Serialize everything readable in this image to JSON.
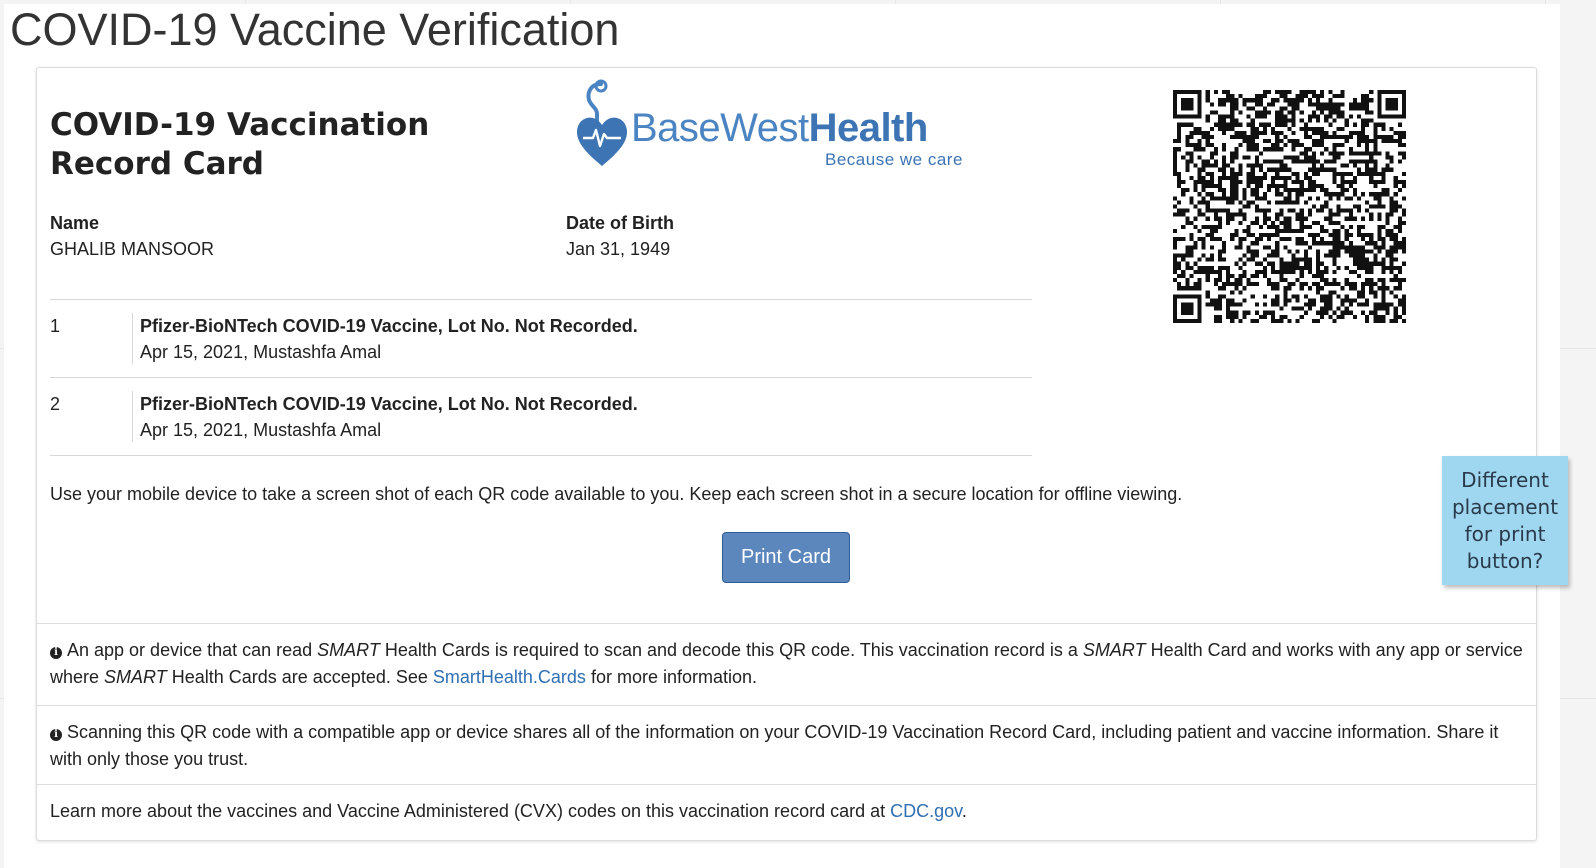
{
  "page": {
    "title": "COVID-19 Vaccine Verification"
  },
  "card": {
    "title": "COVID-19 Vaccination Record Card",
    "logo": {
      "name_part1": "BaseWest",
      "name_part2": "Health",
      "tagline": "Because we care",
      "icon": "heart-stethoscope-icon"
    },
    "qr_code": "qr-code-image",
    "name_label": "Name",
    "name_value": "GHALIB MANSOOR",
    "dob_label": "Date of Birth",
    "dob_value": "Jan 31, 1949",
    "doses": [
      {
        "number": "1",
        "vaccine": "Pfizer-BioNTech COVID-19 Vaccine, Lot No. Not Recorded.",
        "detail": "Apr 15, 2021, Mustashfa Amal"
      },
      {
        "number": "2",
        "vaccine": "Pfizer-BioNTech COVID-19 Vaccine, Lot No. Not Recorded.",
        "detail": "Apr 15, 2021, Mustashfa Amal"
      }
    ],
    "instructions": "Use your mobile device to take a screen shot of each QR code available to you. Keep each screen shot in a secure location for offline viewing.",
    "print_button": "Print Card"
  },
  "notes": {
    "smart": {
      "p1": "An app or device that can read ",
      "em1": "SMART",
      "p2": " Health Cards is required to scan and decode this QR code. This vaccination record is a ",
      "em2": "SMART",
      "p3": " Health Card and works with any app or service where ",
      "em3": "SMART",
      "p4": " Health Cards are accepted. See ",
      "link": "SmartHealth.Cards",
      "p5": " for more information."
    },
    "share": "Scanning this QR code with a compatible app or device shares all of the information on your COVID-19 Vaccination Record Card, including patient and vaccine information. Share it with only those you trust.",
    "cdc": {
      "p1": "Learn more about the vaccines and Vaccine Administered (CVX) codes on this vaccination record card at ",
      "link": "CDC.gov",
      "p2": "."
    }
  },
  "sticky_note": "Different placement for print button?",
  "colors": {
    "brand_blue": "#3c74b4",
    "button": "#5b87bd",
    "sticky": "#9fd7f1",
    "link": "#2f6fb3"
  }
}
